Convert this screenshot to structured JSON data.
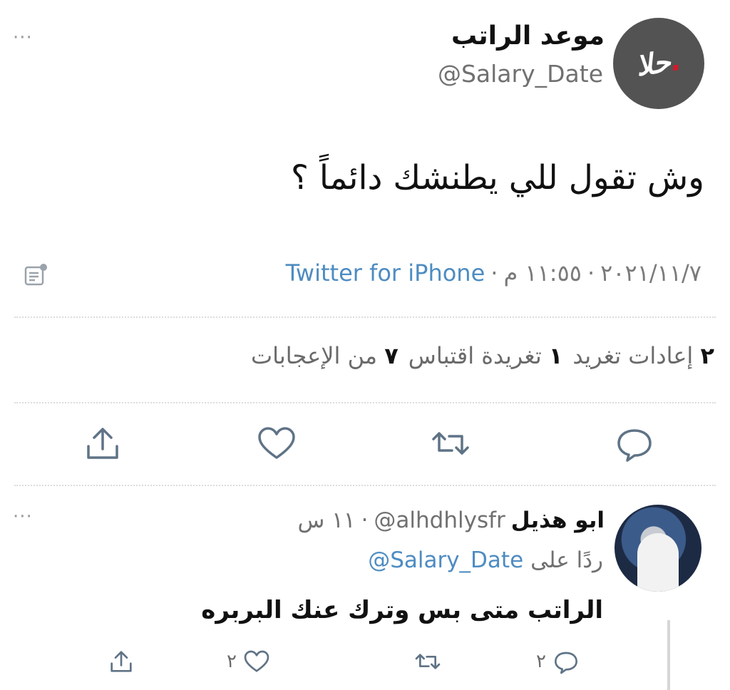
{
  "tweet": {
    "author_name": "موعد الراتب",
    "handle": "@Salary_Date",
    "text": "وش تقول للي يطنشك دائماً ؟",
    "date": "٢٠٢١/١١/٧",
    "time": "١١:٥٥ م",
    "separator": "·",
    "source": "Twitter for iPhone",
    "more_label": "···",
    "avatar_logo_text": "حلا"
  },
  "stats": {
    "retweets_count": "٢",
    "retweets_label": "إعادات تغريد",
    "quotes_count": "١",
    "quotes_label": "تغريدة اقتباس",
    "likes_count": "٧",
    "likes_label": "من الإعجابات"
  },
  "reply": {
    "author_name": "ابو هذيل",
    "handle": "@alhdhlysfr",
    "age": "١١ س",
    "separator": "·",
    "reply_to_prefix": "ردًا على",
    "reply_to_handle": "@Salary_Date",
    "text": "الراتب متى بس وترك عنك البربره",
    "reply_count": "٢",
    "like_count": "٢",
    "more_label": "···"
  },
  "colors": {
    "accent": "#4e8cc2",
    "text": "#111111",
    "muted": "#707070",
    "icon": "#5f7386"
  }
}
